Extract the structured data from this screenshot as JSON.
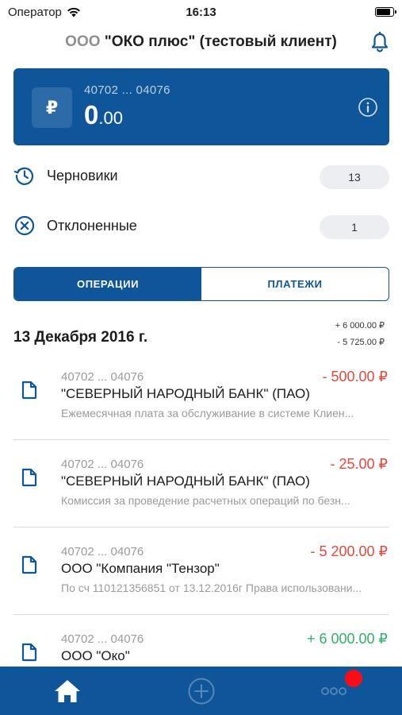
{
  "status_bar": {
    "carrier": "Оператор",
    "time": "16:13"
  },
  "header": {
    "company_prefix": "ООО",
    "company_name": "\"ОКО плюс\" (тестовый клиент)"
  },
  "account": {
    "number": "40702 ... 04076",
    "currency_symbol": "₽",
    "balance_int": "0",
    "balance_frac": ".00"
  },
  "statuses": [
    {
      "label": "Черновики",
      "count": "13"
    },
    {
      "label": "Отклоненные",
      "count": "1"
    }
  ],
  "tabs": {
    "operations": "ОПЕРАЦИИ",
    "payments": "ПЛАТЕЖИ",
    "active": "operations"
  },
  "day": {
    "title": "13 Декабря 2016 г.",
    "income": "+ 6 000.00 ₽",
    "expense": "- 5 725.00 ₽"
  },
  "operations": [
    {
      "account": "40702 ... 04076",
      "amount": "- 500.00 ₽",
      "type": "neg",
      "name": "\"СЕВЕРНЫЙ НАРОДНЫЙ БАНК\" (ПАО)",
      "description": "Ежемесячная плата за обслуживание в системе Клиен..."
    },
    {
      "account": "40702 ... 04076",
      "amount": "- 25.00 ₽",
      "type": "neg",
      "name": "\"СЕВЕРНЫЙ НАРОДНЫЙ БАНК\" (ПАО)",
      "description": "Комиссия за проведение расчетных операций по безн..."
    },
    {
      "account": "40702 ... 04076",
      "amount": "- 5 200.00 ₽",
      "type": "neg",
      "name": "ООО \"Компания \"Тензор\"",
      "description": "По сч 110121356851 от 13.12.2016г Права использовани..."
    },
    {
      "account": "40702 ... 04076",
      "amount": "+ 6 000.00 ₽",
      "type": "pos",
      "name": "ООО \"Око\"",
      "description": ""
    }
  ],
  "icons": {
    "wifi": "wifi-icon",
    "battery": "battery-icon",
    "bell": "bell-icon",
    "info": "info-icon",
    "drafts": "history-clock-icon",
    "rejected": "close-circle-icon",
    "document": "document-icon",
    "home": "home-icon",
    "add": "plus-circle-icon",
    "more": "more-dots-icon"
  },
  "colors": {
    "brand": "#0e559a",
    "negative": "#e8473c",
    "positive": "#2db36a",
    "badge": "#ff0a17"
  },
  "battery_level": 0.9
}
